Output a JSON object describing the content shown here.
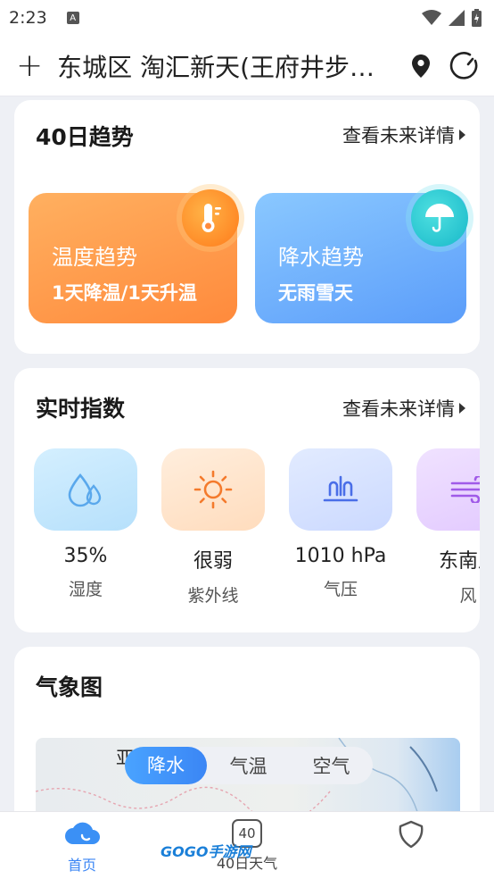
{
  "status_bar": {
    "time": "2:23",
    "badge": "A"
  },
  "header": {
    "location": "东城区 淘汇新天(王府井步…"
  },
  "trend_card": {
    "title": "40日趋势",
    "link": "查看未来详情",
    "temp_tile": {
      "title": "温度趋势",
      "subtitle": "1天降温/1天升温"
    },
    "rain_tile": {
      "title": "降水趋势",
      "subtitle": "无雨雪天"
    }
  },
  "index_card": {
    "title": "实时指数",
    "link": "查看未来详情",
    "items": [
      {
        "value": "35%",
        "label": "湿度",
        "icon": "humidity-icon"
      },
      {
        "value": "很弱",
        "label": "紫外线",
        "icon": "sun-icon"
      },
      {
        "value": "1010 hPa",
        "label": "气压",
        "icon": "pressure-icon"
      },
      {
        "value": "东南风",
        "label": "风",
        "icon": "wind-icon"
      }
    ]
  },
  "map_card": {
    "title": "气象图",
    "map_label": "亚洲",
    "tabs": [
      "降水",
      "气温",
      "空气"
    ],
    "active_tab": "降水"
  },
  "bottom_nav": {
    "items": [
      {
        "label": "首页",
        "icon": "cloud-home-icon",
        "active": true
      },
      {
        "label": "40日天气",
        "icon": "calendar-40-icon",
        "badge": "40"
      },
      {
        "label": "",
        "icon": "shield-icon"
      }
    ]
  },
  "watermark": "GOGO手游网",
  "colors": {
    "accent": "#3b86f5",
    "temp_tile": "#ff8a3c",
    "rain_tile": "#5b9dfa"
  }
}
